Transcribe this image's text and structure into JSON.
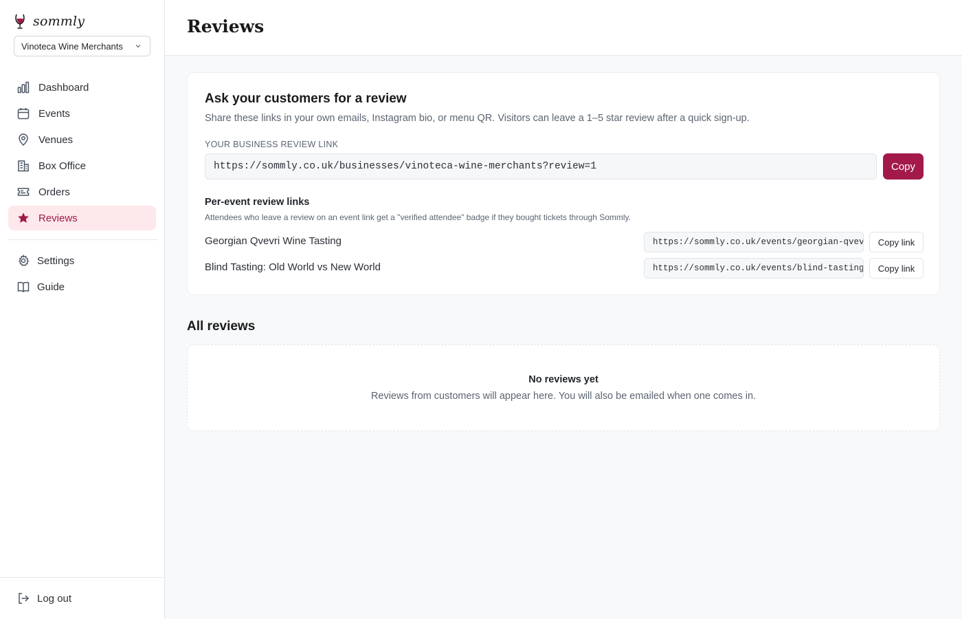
{
  "brand": {
    "name": "sommly",
    "accent": "#a3194a",
    "active_bg": "#fde8ec"
  },
  "org_selector": {
    "value": "Vinoteca Wine Merchants"
  },
  "sidebar": {
    "items": [
      {
        "label": "Dashboard",
        "icon": "bar-chart-icon"
      },
      {
        "label": "Events",
        "icon": "calendar-icon"
      },
      {
        "label": "Venues",
        "icon": "map-pin-icon"
      },
      {
        "label": "Box Office",
        "icon": "building-icon"
      },
      {
        "label": "Orders",
        "icon": "ticket-icon"
      },
      {
        "label": "Reviews",
        "icon": "star-icon",
        "active": true
      }
    ],
    "secondary": [
      {
        "label": "Settings",
        "icon": "gear-icon"
      },
      {
        "label": "Guide",
        "icon": "book-icon"
      }
    ],
    "logout": {
      "label": "Log out",
      "icon": "logout-icon"
    }
  },
  "header": {
    "title": "Reviews"
  },
  "ask_card": {
    "title": "Ask your customers for a review",
    "subtitle": "Share these links in your own emails, Instagram bio, or menu QR. Visitors can leave a 1–5 star review after a quick sign-up.",
    "link_label": "Your business review link",
    "link_value": "https://sommly.co.uk/businesses/vinoteca-wine-merchants?review=1",
    "copy_label": "Copy",
    "per_event_title": "Per-event review links",
    "per_event_subtitle": "Attendees who leave a review on an event link get a \"verified attendee\" badge if they bought tickets through Sommly.",
    "events": [
      {
        "name": "Georgian Qvevri Wine Tasting",
        "url": "https://sommly.co.uk/events/georgian-qvev",
        "copy_label": "Copy link"
      },
      {
        "name": "Blind Tasting: Old World vs New World",
        "url": "https://sommly.co.uk/events/blind-tasting",
        "copy_label": "Copy link"
      }
    ]
  },
  "all_reviews": {
    "title": "All reviews",
    "empty_title": "No reviews yet",
    "empty_subtitle": "Reviews from customers will appear here. You will also be emailed when one comes in."
  }
}
